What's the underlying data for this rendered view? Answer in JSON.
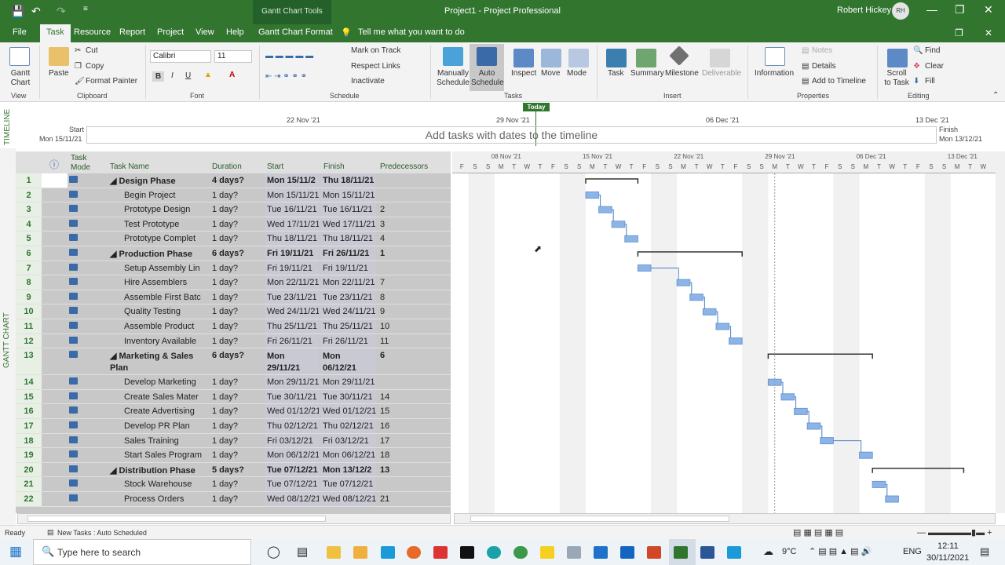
{
  "window": {
    "title": "Project1  -  Project Professional",
    "context_group": "Gantt Chart Tools",
    "user": "Robert Hickey",
    "initials": "RH"
  },
  "tabs": [
    "File",
    "Task",
    "Resource",
    "Report",
    "Project",
    "View",
    "Help",
    "Gantt Chart Format"
  ],
  "tell_me": "Tell me what you want to do",
  "ribbon": {
    "view": {
      "gantt": "Gantt Chart",
      "label": "View"
    },
    "clipboard": {
      "paste": "Paste",
      "cut": "Cut",
      "copy": "Copy",
      "painter": "Format Painter",
      "label": "Clipboard"
    },
    "font": {
      "name": "Calibri",
      "size": "11",
      "label": "Font"
    },
    "schedule": {
      "mark": "Mark on Track",
      "respect": "Respect Links",
      "inactivate": "Inactivate",
      "label": "Schedule"
    },
    "tasks": {
      "manual": "Manually Schedule",
      "auto": "Auto Schedule",
      "inspect": "Inspect",
      "move": "Move",
      "mode": "Mode",
      "label": "Tasks"
    },
    "insert": {
      "task": "Task",
      "summary": "Summary",
      "milestone": "Milestone",
      "deliverable": "Deliverable",
      "label": "Insert"
    },
    "properties": {
      "information": "Information",
      "notes": "Notes",
      "details": "Details",
      "add_timeline": "Add to Timeline",
      "label": "Properties"
    },
    "editing": {
      "scroll": "Scroll to Task",
      "find": "Find",
      "clear": "Clear",
      "fill": "Fill",
      "label": "Editing"
    }
  },
  "timeline": {
    "side_label": "TIMELINE",
    "today": "Today",
    "start_label": "Start",
    "start_date": "Mon 15/11/21",
    "finish_label": "Finish",
    "finish_date": "Mon 13/12/21",
    "placeholder": "Add tasks with dates to the timeline",
    "ticks": [
      "22 Nov '21",
      "29 Nov '21",
      "06 Dec '21",
      "13 Dec '21"
    ]
  },
  "view_label": "GANTT CHART",
  "columns": {
    "mode": "Task Mode",
    "name": "Task Name",
    "duration": "Duration",
    "start": "Start",
    "finish": "Finish",
    "pred": "Predecessors"
  },
  "tasks": [
    {
      "id": "1",
      "name": "Design Phase",
      "dur": "4 days?",
      "start": "Mon 15/11/2",
      "finish": "Thu 18/11/21",
      "pred": "",
      "summary": true
    },
    {
      "id": "2",
      "name": "Begin Project",
      "dur": "1 day?",
      "start": "Mon 15/11/21",
      "finish": "Mon 15/11/21",
      "pred": ""
    },
    {
      "id": "3",
      "name": "Prototype Design",
      "dur": "1 day?",
      "start": "Tue 16/11/21",
      "finish": "Tue 16/11/21",
      "pred": "2"
    },
    {
      "id": "4",
      "name": "Test Prototype",
      "dur": "1 day?",
      "start": "Wed 17/11/21",
      "finish": "Wed 17/11/21",
      "pred": "3"
    },
    {
      "id": "5",
      "name": "Prototype Complet",
      "dur": "1 day?",
      "start": "Thu 18/11/21",
      "finish": "Thu 18/11/21",
      "pred": "4"
    },
    {
      "id": "6",
      "name": "Production Phase",
      "dur": "6 days?",
      "start": "Fri 19/11/21",
      "finish": "Fri 26/11/21",
      "pred": "1",
      "summary": true
    },
    {
      "id": "7",
      "name": "Setup Assembly Lin",
      "dur": "1 day?",
      "start": "Fri 19/11/21",
      "finish": "Fri 19/11/21",
      "pred": ""
    },
    {
      "id": "8",
      "name": "Hire Assemblers",
      "dur": "1 day?",
      "start": "Mon 22/11/21",
      "finish": "Mon 22/11/21",
      "pred": "7"
    },
    {
      "id": "9",
      "name": "Assemble First Batc",
      "dur": "1 day?",
      "start": "Tue 23/11/21",
      "finish": "Tue 23/11/21",
      "pred": "8"
    },
    {
      "id": "10",
      "name": "Quality Testing",
      "dur": "1 day?",
      "start": "Wed 24/11/21",
      "finish": "Wed 24/11/21",
      "pred": "9"
    },
    {
      "id": "11",
      "name": "Assemble Product",
      "dur": "1 day?",
      "start": "Thu 25/11/21",
      "finish": "Thu 25/11/21",
      "pred": "10"
    },
    {
      "id": "12",
      "name": "Inventory Available",
      "dur": "1 day?",
      "start": "Fri 26/11/21",
      "finish": "Fri 26/11/21",
      "pred": "11"
    },
    {
      "id": "13",
      "name": "Marketing & Sales Plan",
      "dur": "6 days?",
      "start": "Mon 29/11/21",
      "finish": "Mon 06/12/21",
      "pred": "6",
      "summary": true,
      "tall": true
    },
    {
      "id": "14",
      "name": "Develop Marketing",
      "dur": "1 day?",
      "start": "Mon 29/11/21",
      "finish": "Mon 29/11/21",
      "pred": ""
    },
    {
      "id": "15",
      "name": "Create Sales Mater",
      "dur": "1 day?",
      "start": "Tue 30/11/21",
      "finish": "Tue 30/11/21",
      "pred": "14"
    },
    {
      "id": "16",
      "name": "Create Advertising",
      "dur": "1 day?",
      "start": "Wed 01/12/21",
      "finish": "Wed 01/12/21",
      "pred": "15"
    },
    {
      "id": "17",
      "name": "Develop PR Plan",
      "dur": "1 day?",
      "start": "Thu 02/12/21",
      "finish": "Thu 02/12/21",
      "pred": "16"
    },
    {
      "id": "18",
      "name": "Sales Training",
      "dur": "1 day?",
      "start": "Fri 03/12/21",
      "finish": "Fri 03/12/21",
      "pred": "17"
    },
    {
      "id": "19",
      "name": "Start Sales Program",
      "dur": "1 day?",
      "start": "Mon 06/12/21",
      "finish": "Mon 06/12/21",
      "pred": "18"
    },
    {
      "id": "20",
      "name": "Distribution Phase",
      "dur": "5 days?",
      "start": "Tue 07/12/21",
      "finish": "Mon 13/12/2",
      "pred": "13",
      "summary": true
    },
    {
      "id": "21",
      "name": "Stock Warehouse",
      "dur": "1 day?",
      "start": "Tue 07/12/21",
      "finish": "Tue 07/12/21",
      "pred": ""
    },
    {
      "id": "22",
      "name": "Process Orders",
      "dur": "1 day?",
      "start": "Wed 08/12/21",
      "finish": "Wed 08/12/21",
      "pred": "21"
    }
  ],
  "gantt_weeks": [
    "08 Nov '21",
    "15 Nov '21",
    "22 Nov '21",
    "29 Nov '21",
    "06 Dec '21",
    "13 Dec '21"
  ],
  "gantt_days": [
    "F",
    "S",
    "S",
    "M",
    "T",
    "W",
    "T",
    "F",
    "S",
    "S",
    "M",
    "T",
    "W",
    "T",
    "F",
    "S",
    "S",
    "M",
    "T",
    "W",
    "T",
    "F",
    "S",
    "S",
    "M",
    "T",
    "W",
    "T",
    "F",
    "S",
    "S",
    "M",
    "T",
    "W",
    "T",
    "F",
    "S",
    "S",
    "M",
    "T",
    "W"
  ],
  "status": {
    "ready": "Ready",
    "new_tasks": "New Tasks : Auto Scheduled"
  },
  "taskbar": {
    "search": "Type here to search",
    "weather": "9°C",
    "lang": "ENG",
    "time": "12:11",
    "date": "30/11/2021"
  }
}
